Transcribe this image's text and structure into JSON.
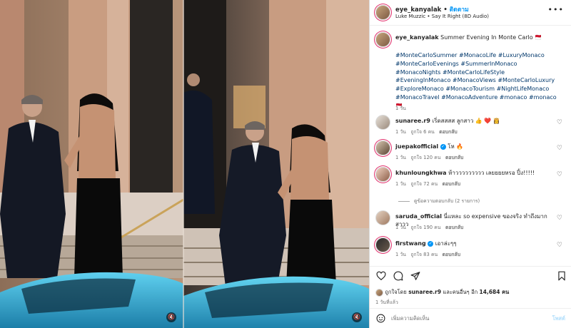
{
  "header": {
    "username": "eye_kanyalak",
    "follow_label": "ติดตาม",
    "audio": "Luke Muzzic • Say It Right (8D Audio)",
    "more_label": "•••"
  },
  "caption": {
    "username": "eye_kanyalak",
    "text": "Summer Evening In Monte Carlo 🇲🇨",
    "hashtags": "#MonteCarloSummer #MonacoLife #LuxuryMonaco #MonteCarloEvenings #SummerInMonaco #MonacoNights #MonteCarloLifeStyle #EveningInMonaco #MonacoViews #MonteCarloLuxury #ExploreMonaco #MonacoTourism #NightLifeMonaco #MonacoTravel #MonacoAdventure #monaco #monaco🇲🇨",
    "time": "1 วัน"
  },
  "comments": [
    {
      "username": "sunaree.r9",
      "verified": false,
      "text": "เริ่ดสสสส ลูกสาว 👍 ❤️ 👸",
      "time": "1 วัน",
      "likes": "ถูกใจ 6 คน",
      "reply": "ตอบกลับ"
    },
    {
      "username": "juepakofficial",
      "verified": true,
      "text": "โห 🔥",
      "time": "1 วัน",
      "likes": "ถูกใจ 120 คน",
      "reply": "ตอบกลับ"
    },
    {
      "username": "khunloungkhwa",
      "verified": false,
      "text": "ห้าววววววววว เลยยยยหรอ ปิ้ง!!!!!",
      "time": "1 วัน",
      "likes": "ถูกใจ 72 คน",
      "reply": "ตอบกลับ"
    },
    {
      "username": "saruda_official",
      "verified": false,
      "text": "นี่แหละ so expensive ของจริง ทำถึงมากสาวว",
      "time": "1 วัน",
      "likes": "ถูกใจ 190 คน",
      "reply": "ตอบกลับ"
    },
    {
      "username": "firstwang",
      "verified": true,
      "text": "เอาล่ะๆๆ",
      "time": "1 วัน",
      "likes": "ถูกใจ 83 คน",
      "reply": "ตอบกลับ"
    }
  ],
  "view_replies": "ดูข้อความตอบกลับ (2 รายการ)",
  "actions": {
    "like_icon": "heart-outline-icon",
    "comment_icon": "comment-icon",
    "share_icon": "send-icon",
    "save_icon": "bookmark-icon"
  },
  "likes_summary": {
    "prefix": "ถูกใจโดย",
    "user": "sunaree.r9",
    "middle": "และคนอื่นๆ อีก",
    "count": "14,684 คน"
  },
  "post_time": "1 วันที่แล้ว",
  "add_comment": {
    "placeholder": "เพิ่มความคิดเห็น",
    "post_label": "โพสต์"
  },
  "colors": {
    "accent": "#0095f6",
    "link": "#00376b",
    "muted": "#737373",
    "car": "#3fb2d9"
  }
}
